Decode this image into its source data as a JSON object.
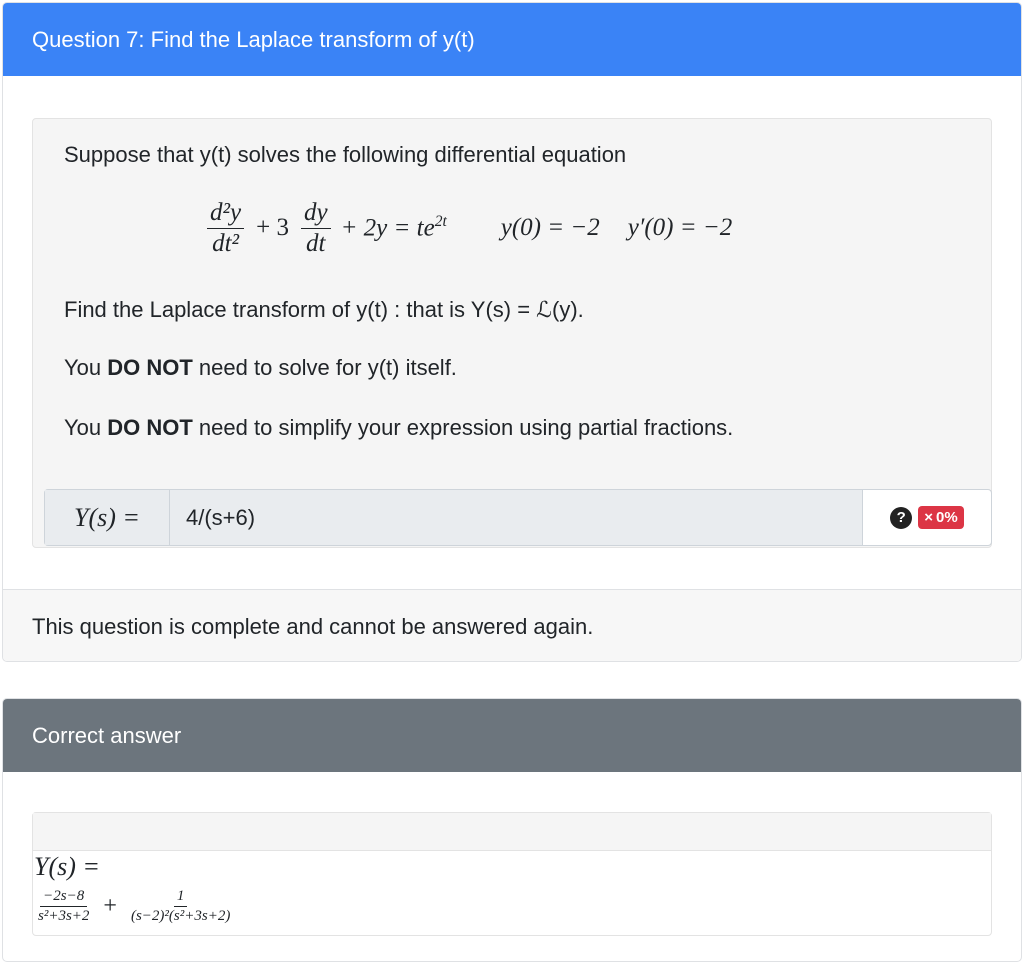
{
  "question": {
    "header": "Question 7: Find the Laplace transform of y(t)",
    "intro": "Suppose that y(t) solves the following differential equation",
    "equation": {
      "d2y": "d²y",
      "dt2": "dt²",
      "plus1": "+ 3",
      "dy": "dy",
      "dt": "dt",
      "rhs": "+ 2y = te",
      "rhs_exp": "2t",
      "ic1": "y(0) = −2",
      "ic2": "y′(0) = −2"
    },
    "task_text": "Find the Laplace transform of y(t) : that is Y(s) = ℒ(y).",
    "note1_prefix": "You ",
    "note1_bold": "DO NOT",
    "note1_suffix": " need to solve for y(t) itself.",
    "note2_prefix": "You ",
    "note2_bold": "DO NOT",
    "note2_suffix": " need to simplify your expression using partial fractions.",
    "input_prefix": "Y(s) =",
    "answer_value": "4/(s+6)",
    "help_icon": "?",
    "score_label": "0%",
    "score_icon": "×",
    "status": "This question is complete and cannot be answered again."
  },
  "correct": {
    "header": "Correct answer",
    "lhs": "Y(s) =",
    "frac1_num": "−2s−8",
    "frac1_den": "s²+3s+2",
    "plus": "+",
    "frac2_num": "1",
    "frac2_den": "(s−2)²(s²+3s+2)"
  },
  "colors": {
    "header_blue": "#3a83f6",
    "header_gray": "#6c757d",
    "score_red": "#dc3545"
  }
}
